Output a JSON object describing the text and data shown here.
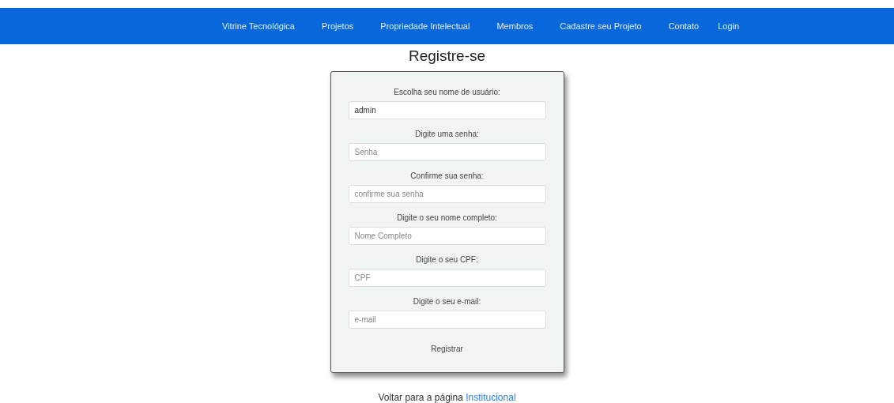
{
  "nav": {
    "items": [
      "Vitrine Tecnológica",
      "Projetos",
      "Propriedade Intelectual",
      "Membros",
      "Cadastre seu Projeto",
      "Contato",
      "Login"
    ]
  },
  "title": "Registre-se",
  "form": {
    "fields": [
      {
        "label": "Escolha seu nome de usuário:",
        "value": "admin"
      },
      {
        "label": "Digite uma senha:",
        "placeholder": "Senha"
      },
      {
        "label": "Confirme sua senha:",
        "placeholder": "confirme sua senha"
      },
      {
        "label": "Digite o seu nome completo:",
        "placeholder": "Nome Completo"
      },
      {
        "label": "Digite o seu CPF:",
        "placeholder": "CPF"
      },
      {
        "label": "Digite o seu e-mail:",
        "placeholder": "e-mail"
      }
    ],
    "submit": "Registrar"
  },
  "footer": {
    "text": "Voltar para a página",
    "link": "Institucional"
  }
}
